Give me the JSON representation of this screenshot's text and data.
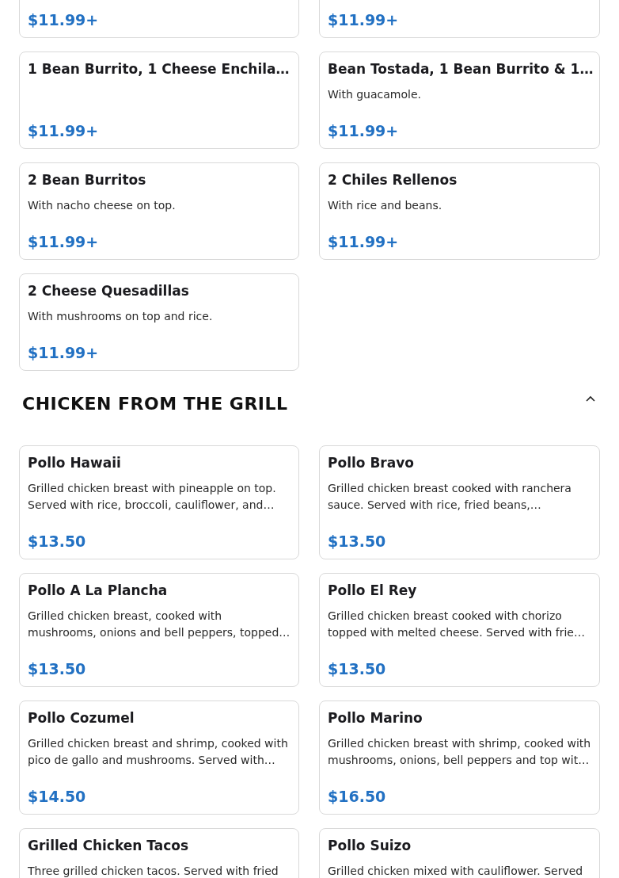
{
  "sections": [
    {
      "items": [
        {
          "price": "$11.99+"
        },
        {
          "price": "$11.99+"
        },
        {
          "name": "1 Bean Burrito, 1 Cheese Enchila…",
          "price": "$11.99+"
        },
        {
          "name": "Bean Tostada, 1 Bean Burrito & 1…",
          "description": "With guacamole.",
          "price": "$11.99+"
        },
        {
          "name": "2 Bean Burritos",
          "description": "With nacho cheese on top.",
          "price": "$11.99+"
        },
        {
          "name": "2 Chiles Rellenos",
          "description": "With rice and beans.",
          "price": "$11.99+"
        },
        {
          "name": "2 Cheese Quesadillas",
          "description": "With mushrooms on top and rice.",
          "price": "$11.99+"
        }
      ]
    },
    {
      "title": "CHICKEN FROM THE GRILL",
      "expanded": true,
      "items": [
        {
          "name": "Pollo Hawaii",
          "description": "Grilled chicken breast with pineapple on top. Served with rice, broccoli, cauliflower, and…",
          "price": "$13.50"
        },
        {
          "name": "Pollo Bravo",
          "description": "Grilled chicken breast cooked with ranchera sauce. Served with rice, fried beans,…",
          "price": "$13.50"
        },
        {
          "name": "Pollo A La Plancha",
          "description": "Grilled chicken breast, cooked with mushrooms, onions and bell peppers, topped…",
          "price": "$13.50"
        },
        {
          "name": "Pollo El Rey",
          "description": "Grilled chicken breast cooked with chorizo topped with melted cheese. Served with frie…",
          "price": "$13.50"
        },
        {
          "name": "Pollo Cozumel",
          "description": "Grilled chicken breast and shrimp, cooked with pico de gallo and mushrooms. Served with…",
          "price": "$14.50"
        },
        {
          "name": "Pollo Marino",
          "description": "Grilled chicken breast with shrimp, cooked with mushrooms, onions, bell peppers and top wit…",
          "price": "$16.50"
        },
        {
          "name": "Grilled Chicken Tacos",
          "description": "Three grilled chicken tacos. Served with fried"
        },
        {
          "name": "Pollo Suizo",
          "description": "Grilled chicken mixed with cauliflower. Served"
        }
      ]
    }
  ]
}
